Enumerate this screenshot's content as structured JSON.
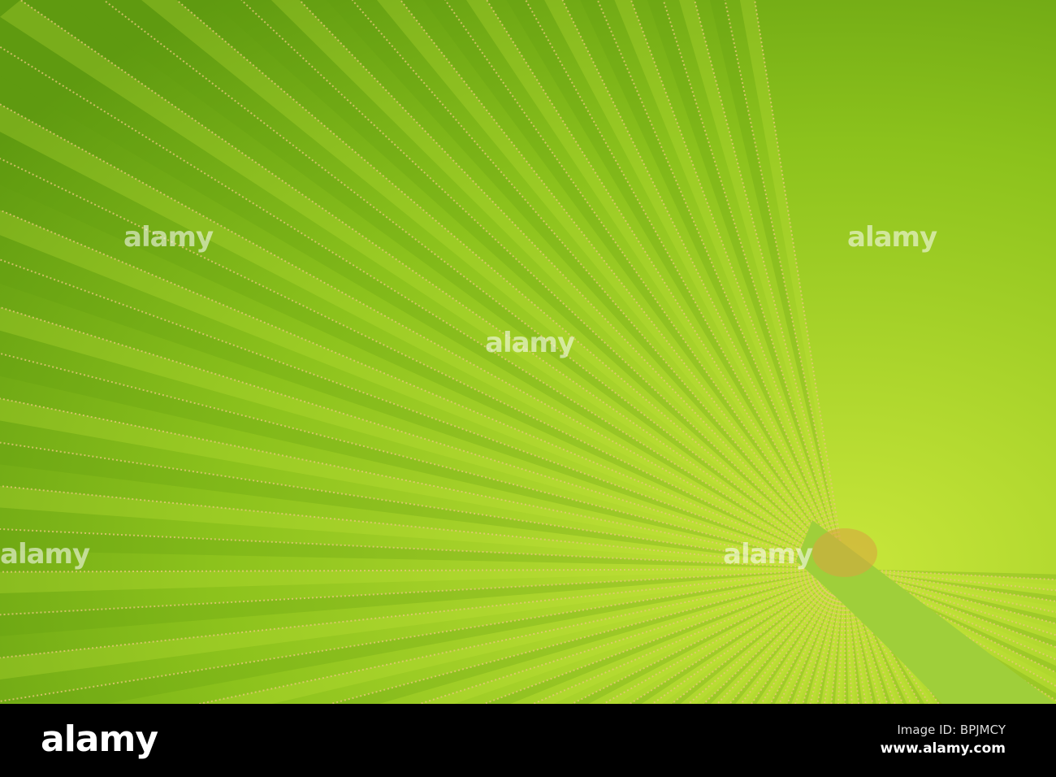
{
  "photo": {
    "subject": "palm-leaf",
    "colors": {
      "leaf_light": "#c8e63a",
      "leaf_mid": "#8cc21c",
      "leaf_dark": "#5f9a10",
      "seam": "#e8c77a",
      "stalk": "#9fcf3a"
    }
  },
  "watermark": {
    "text": "alamy"
  },
  "footer": {
    "logo": "alamy",
    "image_id": "Image ID: BPJMCY",
    "url": "www.alamy.com"
  }
}
